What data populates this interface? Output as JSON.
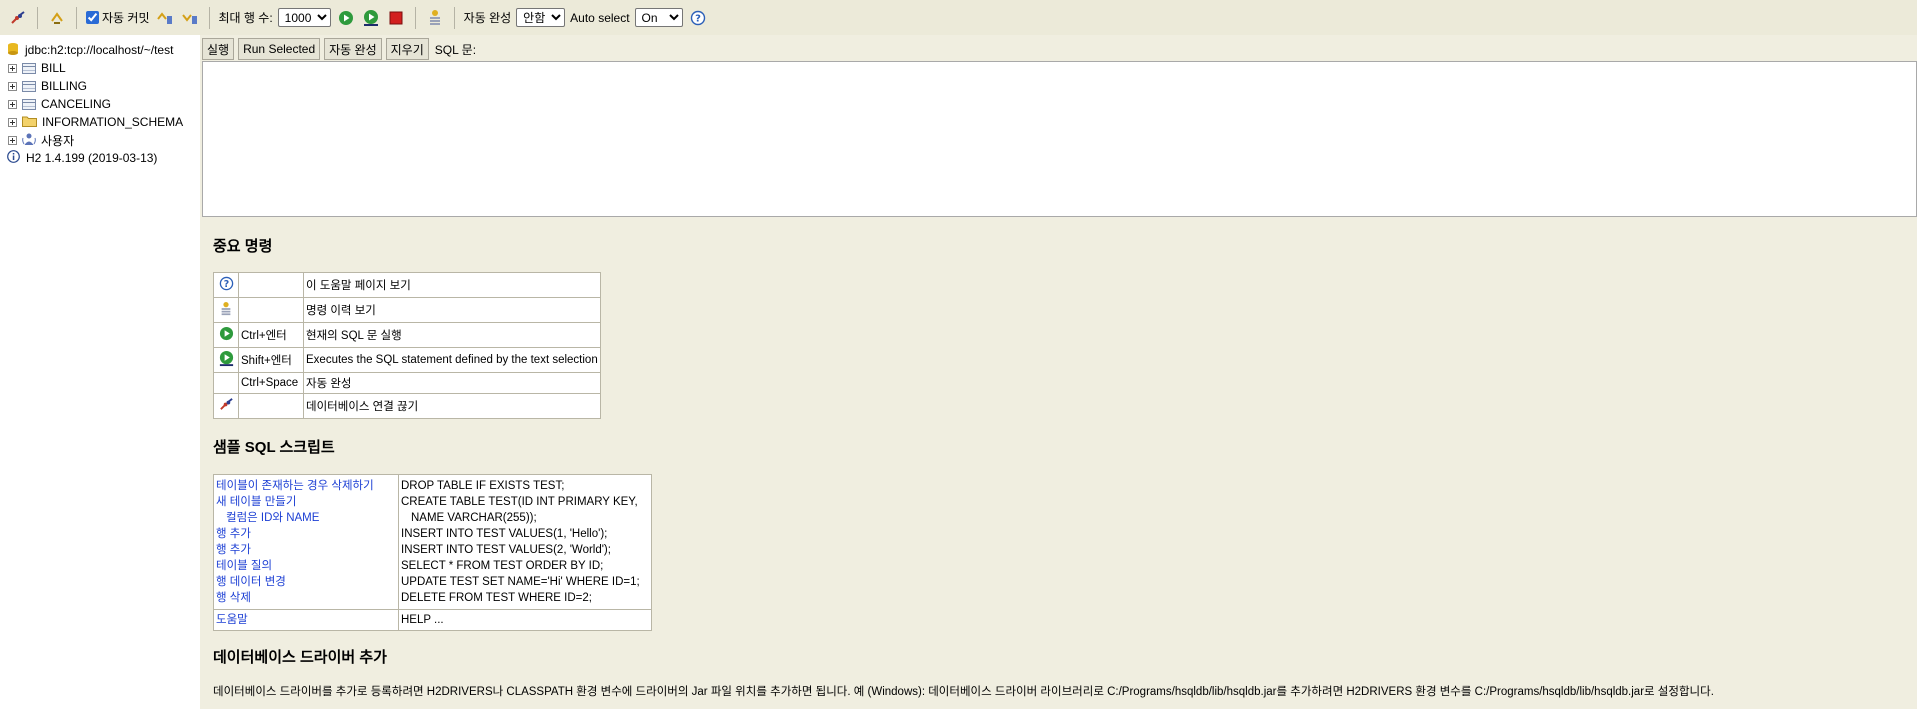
{
  "toolbar": {
    "autocommit_label": "자동 커밋",
    "autocommit_checked": true,
    "max_rows_label": "최대 행 수:",
    "max_rows_value": "1000",
    "autocomplete_label": "자동 완성",
    "autocomplete_value": "안함",
    "autoselect_label": "Auto select",
    "autoselect_value": "On"
  },
  "tree": {
    "connection": "jdbc:h2:tcp://localhost/~/test",
    "items": [
      {
        "label": "BILL",
        "icon": "table-icon"
      },
      {
        "label": "BILLING",
        "icon": "table-icon"
      },
      {
        "label": "CANCELING",
        "icon": "table-icon"
      },
      {
        "label": "INFORMATION_SCHEMA",
        "icon": "folder-icon"
      },
      {
        "label": "사용자",
        "icon": "users-icon"
      }
    ],
    "version": "H2 1.4.199 (2019-03-13)"
  },
  "sql_toolbar": {
    "run": "실행",
    "run_selected": "Run Selected",
    "autocomplete": "자동 완성",
    "clear": "지우기",
    "sql_label": "SQL 문:"
  },
  "help": {
    "important_title": "중요 명령",
    "commands": [
      {
        "icon": "help-icon",
        "key": "",
        "desc": "이 도움말 페이지 보기"
      },
      {
        "icon": "history-icon",
        "key": "",
        "desc": "명령 이력 보기"
      },
      {
        "icon": "run-icon",
        "key": "Ctrl+엔터",
        "desc": "현재의 SQL 문 실행"
      },
      {
        "icon": "run-selected-icon",
        "key": "Shift+엔터",
        "desc": "Executes the SQL statement defined by the text selection"
      },
      {
        "icon": "",
        "key": "Ctrl+Space",
        "desc": "자동 완성"
      },
      {
        "icon": "disconnect-icon",
        "key": "",
        "desc": "데이터베이스 연결 끊기"
      }
    ],
    "sample_title": "샘플 SQL 스크립트",
    "samples": {
      "links": [
        "테이블이 존재하는 경우 삭제하기",
        "새 테이블 만들기",
        "  컬럼은 ID와 NAME",
        "행 추가",
        "행 추가",
        "테이블 질의",
        "행 데이터 변경",
        "행 삭제"
      ],
      "sql": [
        "DROP TABLE IF EXISTS TEST;",
        "CREATE TABLE TEST(ID INT PRIMARY KEY,",
        "   NAME VARCHAR(255));",
        "INSERT INTO TEST VALUES(1, 'Hello');",
        "INSERT INTO TEST VALUES(2, 'World');",
        "SELECT * FROM TEST ORDER BY ID;",
        "UPDATE TEST SET NAME='Hi' WHERE ID=1;",
        "DELETE FROM TEST WHERE ID=2;"
      ],
      "help_link": "도움말",
      "help_sql": "HELP ..."
    },
    "driver_title": "데이터베이스 드라이버 추가",
    "driver_text": "데이터베이스 드라이버를 추가로 등록하려면 H2DRIVERS나 CLASSPATH 환경 변수에 드라이버의 Jar 파일 위치를 추가하면 됩니다. 예 (Windows): 데이터베이스 드라이버 라이브러리로 C:/Programs/hsqldb/lib/hsqldb.jar를 추가하려면 H2DRIVERS 환경 변수를 C:/Programs/hsqldb/lib/hsqldb.jar로 설정합니다."
  }
}
